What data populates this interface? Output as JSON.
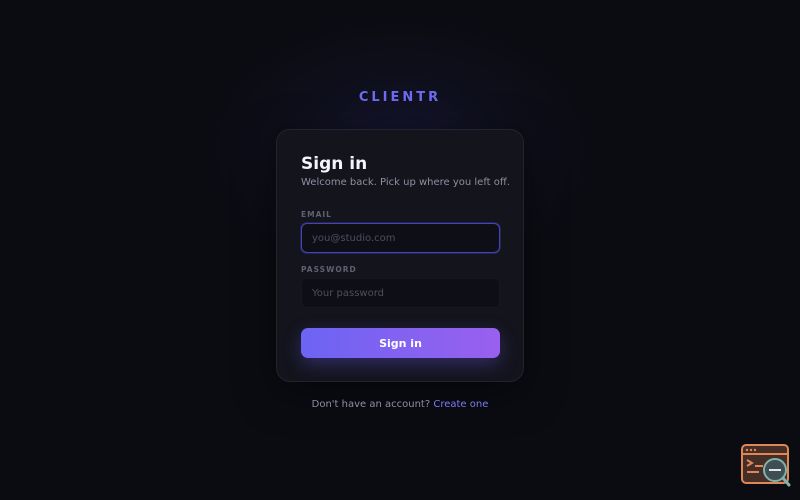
{
  "brand": {
    "name": "CLIENTR"
  },
  "card": {
    "title": "Sign in",
    "subtitle": "Welcome back. Pick up where you left off."
  },
  "form": {
    "email": {
      "label": "EMAIL",
      "placeholder": "you@studio.com",
      "value": ""
    },
    "password": {
      "label": "PASSWORD",
      "placeholder": "Your password",
      "value": ""
    },
    "submit_label": "Sign in"
  },
  "footer": {
    "prompt": "Don't have an account?",
    "link_label": "Create one"
  },
  "colors": {
    "background": "#0b0c12",
    "accent": "#6d6cf2",
    "button_start": "#6c64f3",
    "button_end": "#9a60ee",
    "devtools_badge": "#e0875a"
  },
  "icons": {
    "devtools": "devtools-inspect-icon"
  }
}
